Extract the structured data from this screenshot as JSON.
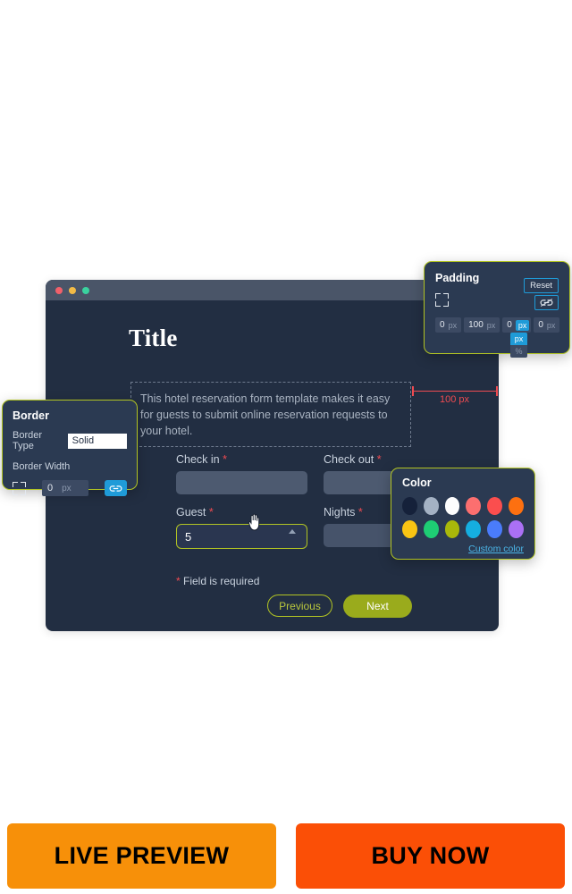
{
  "window": {
    "traffic_lights": [
      "close",
      "minimize",
      "maximize"
    ]
  },
  "form": {
    "title": "Title",
    "description": "This hotel reservation form template makes it easy for guests to submit online reservation requests to your hotel.",
    "fields": [
      {
        "label": "Check in",
        "required_mark": "*",
        "value": ""
      },
      {
        "label": "Check out",
        "required_mark": "*",
        "value": ""
      },
      {
        "label": "Guest",
        "required_mark": "*",
        "value": "5"
      },
      {
        "label": "Nights",
        "required_mark": "*",
        "value": ""
      }
    ],
    "required_note_mark": "*",
    "required_note": "Field is required",
    "buttons": {
      "previous": "Previous",
      "next": "Next"
    }
  },
  "measurement": {
    "label": "100 px"
  },
  "padding_panel": {
    "title": "Padding",
    "reset_label": "Reset",
    "unlink_icon": "broken-chain-icon",
    "corner_icon": "padding-corners-icon",
    "values": [
      {
        "value": "0",
        "unit": "px"
      },
      {
        "value": "100",
        "unit": "px"
      },
      {
        "value": "0",
        "unit": "px"
      },
      {
        "value": "0",
        "unit": "px"
      }
    ],
    "unit_dropdown": {
      "selected": "px",
      "options": [
        "px",
        "%"
      ]
    }
  },
  "border_panel": {
    "title": "Border",
    "type_label": "Border Type",
    "type_value": "Solid",
    "width_label": "Border Width",
    "width_value": "0",
    "width_unit": "px",
    "corner_icon": "border-corners-icon",
    "link_icon": "chain-link-icon"
  },
  "color_panel": {
    "title": "Color",
    "custom_color_label": "Custom color",
    "swatches_row1": [
      "#15213a",
      "#a4b2c4",
      "#fdfdfd",
      "#fc6f6f",
      "#fb4e4e",
      "#fd7010"
    ],
    "swatches_row2": [
      "#f9c413",
      "#1ecd74",
      "#a9b80a",
      "#15aee0",
      "#4a7cfb",
      "#aa70f5"
    ]
  },
  "cta": {
    "live_preview": "LIVE PREVIEW",
    "buy_now": "BUY NOW",
    "live_color": "#f79009",
    "buy_color": "#fb4f06"
  },
  "theme": {
    "window_bg": "#222e42",
    "titlebar_bg": "#4a5568",
    "panel_bg": "#2b3a52",
    "panel_border": "#b2c423",
    "accent_blue": "#1f9bd8",
    "accent_olive": "#9aab1c",
    "required_red": "#ef4b51"
  }
}
